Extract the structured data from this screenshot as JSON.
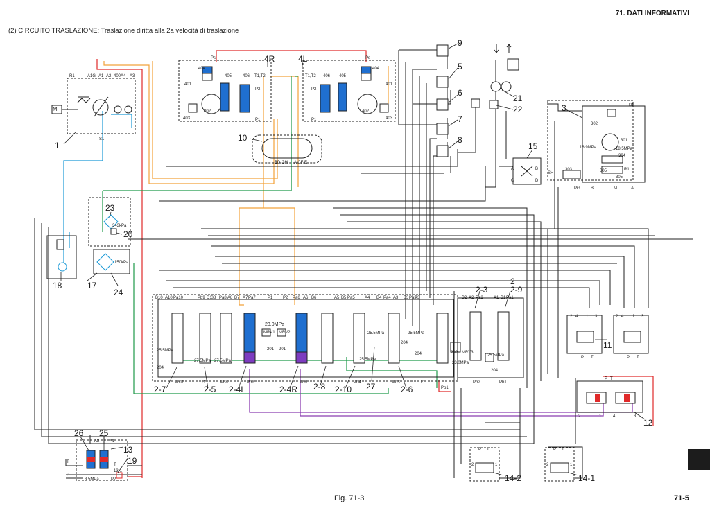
{
  "header": {
    "section_title": "71. DATI INFORMATIVI"
  },
  "subtitle": "(2)  CIRCUITO TRASLAZIONE: Traslazione diritta alla 2a velocità di traslazione",
  "figure": {
    "caption": "Fig. 71-3"
  },
  "page_number": "71-5",
  "colors": {
    "line": "#222222",
    "pilot_red": "#e02a2a",
    "orange": "#f2a23a",
    "blue": "#1e9bd7",
    "green": "#1f9a4a",
    "purple": "#8b3db0",
    "spool_blue": "#1f6fd0",
    "spool_purple": "#7d3cc0"
  },
  "schematic": {
    "callouts": [
      "1",
      "3",
      "4R",
      "4L",
      "5",
      "6",
      "7",
      "8",
      "9",
      "10",
      "11",
      "12",
      "13",
      "14-1",
      "14-2",
      "15",
      "17",
      "18",
      "19",
      "20",
      "21",
      "22",
      "23",
      "24",
      "25",
      "26",
      "27",
      "2-3",
      "2-9",
      "2-7",
      "2-5",
      "2-4L",
      "2-4R",
      "2-8",
      "2-10",
      "2-6"
    ],
    "port_labels": [
      "M",
      "R1",
      "A1G",
      "A1",
      "A2",
      "400",
      "A4",
      "A3",
      "S1",
      "Ps",
      "401",
      "402",
      "403",
      "404",
      "405",
      "406",
      "P1",
      "P2",
      "T1,T2",
      "BD GH",
      "A CF E",
      "DB",
      "302",
      "301",
      "304",
      "305",
      "303",
      "PG",
      "B",
      "A",
      "SH",
      "C",
      "D",
      "B10",
      "A10",
      "Pa10",
      "Pb9",
      "D1",
      "B8",
      "Pa8",
      "A8",
      "B7",
      "A7",
      "Pa7",
      "P1",
      "P2",
      "Pa6",
      "A6",
      "B6",
      "A5",
      "B5",
      "Pa5",
      "A4",
      "B4",
      "Pa4",
      "A3",
      "B3",
      "Pa3",
      "P3",
      "B2",
      "A2",
      "Pa2",
      "A1",
      "B1",
      "Pa1",
      "Pb10",
      "T2",
      "Pb8",
      "Pb7",
      "Pb6",
      "Pb4",
      "Pb3",
      "T1",
      "Pb2",
      "Pb1",
      "MRV1",
      "MRV2",
      "MRV3",
      "201",
      "202",
      "204",
      "Pp1",
      "T",
      "P",
      "2",
      "4",
      "1",
      "3",
      "P2",
      "3.5MPa",
      "13-1"
    ],
    "pressures": [
      "343kPa",
      "150kPa",
      "23.0MPa",
      "23.0MPa",
      "25.5MPa",
      "27.5MPa",
      "25.5MPa",
      "25.5MPa",
      "18.5MPa",
      "18.9MPa"
    ]
  }
}
